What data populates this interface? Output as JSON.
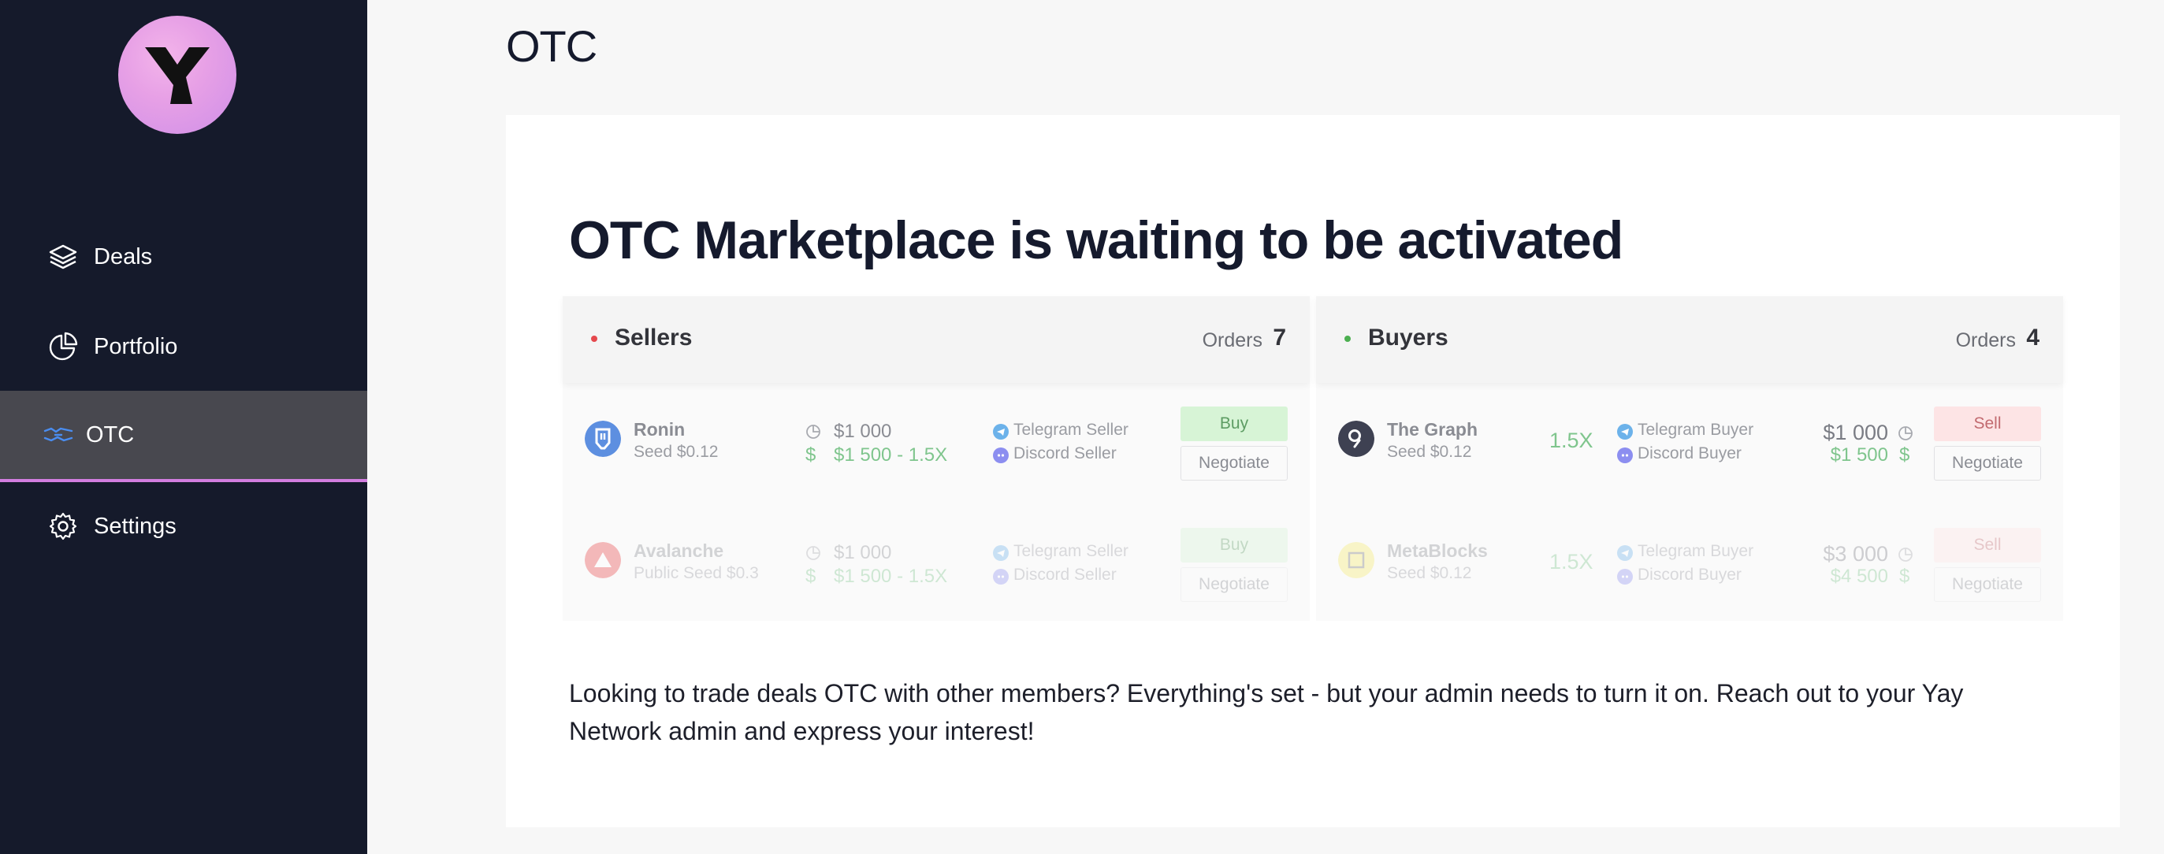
{
  "sidebar": {
    "nav": {
      "deals": "Deals",
      "portfolio": "Portfolio",
      "otc": "OTC",
      "settings": "Settings"
    },
    "active": "OTC"
  },
  "header": {
    "title": "OTC"
  },
  "main": {
    "headline": "OTC Marketplace is waiting to be activated",
    "description": "Looking to trade deals OTC with other members? Everything's set - but your admin needs to turn it on. Reach out to your Yay Network admin and express your interest!",
    "sellers": {
      "title": "Sellers",
      "orders_label": "Orders",
      "orders_count": "7",
      "rows": [
        {
          "name": "Ronin",
          "round": "Seed $0.12",
          "price1": "$1 000",
          "price2": "$1 500 - 1.5X",
          "contact1": "Telegram Seller",
          "contact2": "Discord Seller",
          "action": "Buy",
          "negotiate": "Negotiate"
        },
        {
          "name": "Avalanche",
          "round": "Public Seed $0.3",
          "price1": "$1 000",
          "price2": "$1 500 - 1.5X",
          "contact1": "Telegram Seller",
          "contact2": "Discord Seller",
          "action": "Buy",
          "negotiate": "Negotiate"
        }
      ]
    },
    "buyers": {
      "title": "Buyers",
      "orders_label": "Orders",
      "orders_count": "4",
      "rows": [
        {
          "name": "The Graph",
          "round": "Seed $0.12",
          "multiplier": "1.5X",
          "contact1": "Telegram Buyer",
          "contact2": "Discord Buyer",
          "price1": "$1 000",
          "price2": "$1 500",
          "action": "Sell",
          "negotiate": "Negotiate"
        },
        {
          "name": "MetaBlocks",
          "round": "Seed $0.12",
          "multiplier": "1.5X",
          "contact1": "Telegram Buyer",
          "contact2": "Discord Buyer",
          "price1": "$3 000",
          "price2": "$4 500",
          "action": "Sell",
          "negotiate": "Negotiate"
        }
      ]
    }
  },
  "colors": {
    "sidebar_bg": "#151a2b",
    "active_item_bg": "#48484f",
    "active_accent": "#d27ee0",
    "seller_dot": "#e5484d",
    "buyer_dot": "#4caf50",
    "buy_button": "#d7f4d6",
    "sell_button": "#fde4e5"
  },
  "icons": {
    "deals": "layers-icon",
    "portfolio": "pie-chart-icon",
    "otc": "handshake-icon",
    "settings": "gear-icon"
  }
}
